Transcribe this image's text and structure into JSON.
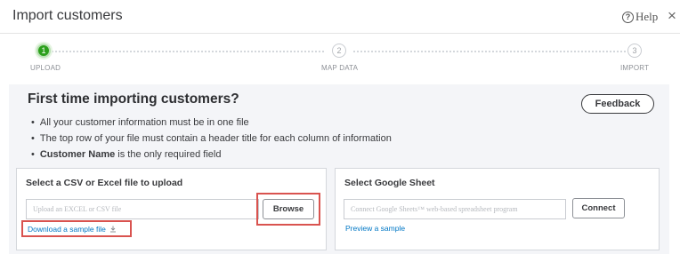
{
  "dialog": {
    "title": "Import customers",
    "help_label": "Help",
    "help_icon_glyph": "?",
    "close_glyph": "×"
  },
  "stepper": {
    "steps": [
      {
        "number": "1",
        "label": "UPLOAD",
        "active": true
      },
      {
        "number": "2",
        "label": "MAP DATA",
        "active": false
      },
      {
        "number": "3",
        "label": "IMPORT",
        "active": false
      }
    ],
    "active_color": "#2ca01c"
  },
  "main": {
    "heading": "First time importing customers?",
    "feedback_label": "Feedback",
    "bullets": [
      "All your customer information must be in one file",
      "The top row of your file must contain a header title for each column of information"
    ],
    "bullet3_bold": "Customer Name",
    "bullet3_rest": " is the only required field"
  },
  "csv_card": {
    "title": "Select a CSV or Excel file to upload",
    "input_placeholder": "Upload an EXCEL or CSV file",
    "browse_label": "Browse",
    "sample_link": "Download a sample file",
    "sample_link_icon": "download-icon"
  },
  "sheet_card": {
    "title": "Select Google Sheet",
    "input_placeholder": "Connect Google Sheets™ web-based spreadsheet program",
    "connect_label": "Connect",
    "preview_link": "Preview a sample"
  },
  "colors": {
    "link": "#0077c5",
    "highlight": "#d9534f",
    "panel_bg": "#f4f5f8"
  }
}
